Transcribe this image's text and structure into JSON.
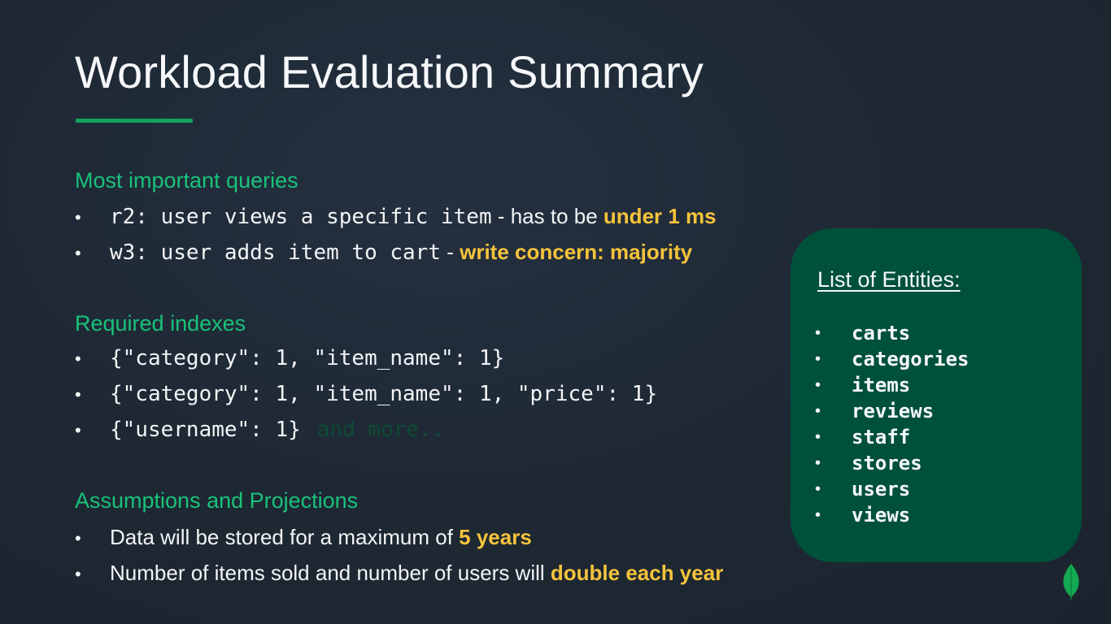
{
  "title": "Workload Evaluation Summary",
  "sections": {
    "queries": {
      "heading": "Most important queries",
      "items": [
        {
          "code": "r2: user views a specific item",
          "sep": " - ",
          "plain": "has to be ",
          "highlight": "under 1 ms"
        },
        {
          "code": "w3: user adds item to cart",
          "sep": " - ",
          "plain": "",
          "highlight": "write concern: majority"
        }
      ]
    },
    "indexes": {
      "heading": "Required indexes",
      "items": [
        {
          "code": "{\"category\": 1, \"item_name\": 1}",
          "faded": ""
        },
        {
          "code": "{\"category\": 1, \"item_name\": 1, \"price\": 1}",
          "faded": ""
        },
        {
          "code": "{\"username\": 1}",
          "faded": "and more.."
        }
      ]
    },
    "assumptions": {
      "heading": "Assumptions and Projections",
      "items": [
        {
          "plain": "Data will be stored for a maximum of ",
          "highlight": "5 years"
        },
        {
          "plain": "Number of items sold and number of users will ",
          "highlight": "double each year"
        }
      ]
    }
  },
  "entities": {
    "title": "List of Entities:",
    "items": [
      "carts",
      "categories",
      "items",
      "reviews",
      "staff",
      "stores",
      "users",
      "views"
    ]
  },
  "bullet_char": "•",
  "colors": {
    "background": "#1e2833",
    "accent_green": "#19c27a",
    "highlight_yellow": "#f5c33b",
    "entity_box": "#00513a",
    "faded_text": "#0f4a32"
  },
  "icons": {
    "brand": "leaf-icon"
  }
}
